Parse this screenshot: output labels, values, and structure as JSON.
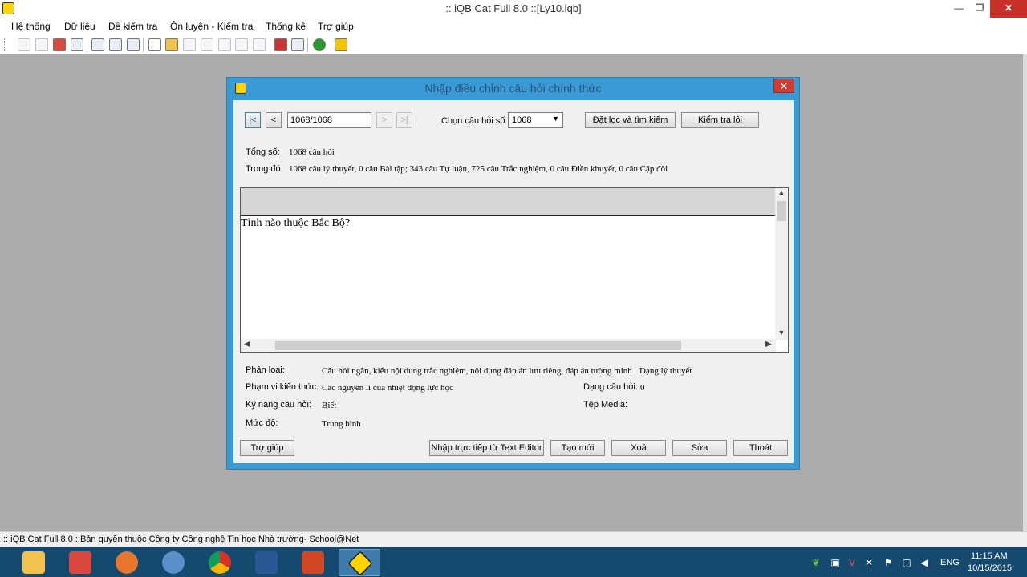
{
  "window": {
    "title": ":: iQB Cat Full 8.0 ::[Ly10.iqb]",
    "minimize_glyph": "—",
    "restore_glyph": "❐",
    "close_glyph": "✕"
  },
  "menu": {
    "items": [
      "Hệ thống",
      "Dữ liệu",
      "Đề kiểm tra",
      "Ôn luyện - Kiểm tra",
      "Thống kê",
      "Trợ giúp"
    ]
  },
  "dialog": {
    "title": "Nhập điều chỉnh câu hỏi chính thức",
    "close_glyph": "✕",
    "nav": {
      "first": "|<",
      "prev": "<",
      "position": "1068/1068",
      "next": ">",
      "last": ">|"
    },
    "select_label": "Chọn câu hỏi số:",
    "select_value": "1068",
    "filter_button": "Đặt lọc và tìm kiếm",
    "check_button": "Kiểm tra lỗi",
    "total_label": "Tổng số:",
    "total_value": "1068 câu hỏi",
    "breakdown_label": "Trong đó:",
    "breakdown_value": "1068 câu lý thuyết, 0 câu Bài tập; 343 câu Tự luận, 725 câu Trắc nghiệm, 0 câu Điền khuyết, 0 câu Cặp đôi",
    "question_text": "Tỉnh nào thuộc Bắc Bộ?",
    "classification_label": "Phân loại:",
    "classification_value": "Câu hỏi ngắn, kiểu nội dung trắc nghiệm, nội dung đáp án lưu riêng, đáp án tường minh",
    "classification_type": "Dạng lý thuyết",
    "scope_label": "Phạm vi kiến thức:",
    "scope_value": "Các nguyên lí của nhiệt động lực học",
    "qtype_label": "Dạng câu hỏi:",
    "qtype_value": "0",
    "skill_label": "Kỹ năng câu hỏi:",
    "skill_value": "Biết",
    "media_label": "Tệp Media:",
    "level_label": "Mức độ:",
    "level_value": "Trung bình",
    "buttons": {
      "help": "Trợ giúp",
      "text_editor": "Nhập trực tiếp từ Text Editor",
      "new": "Tạo mới",
      "delete": "Xoá",
      "edit": "Sửa",
      "exit": "Thoát"
    }
  },
  "statusbar": {
    "text": ":: iQB Cat Full 8.0 ::Bản quyền thuộc Công ty Công nghệ Tin học Nhà trường- School@Net"
  },
  "taskbar": {
    "apps": [
      {
        "icon": "file-explorer-icon",
        "color": "#f2c14e"
      },
      {
        "icon": "app-icon",
        "color": "#d9473f"
      },
      {
        "icon": "firefox-icon",
        "color": "#e8762d"
      },
      {
        "icon": "thunderbird-icon",
        "color": "#5b8fc9"
      },
      {
        "icon": "chrome-icon",
        "color": "#3a9a4a"
      },
      {
        "icon": "word-icon",
        "color": "#2b5797"
      },
      {
        "icon": "powerpoint-icon",
        "color": "#d24726"
      },
      {
        "icon": "iqb-icon",
        "color": "#ffd400"
      }
    ],
    "lang": "ENG",
    "time": "11:15 AM",
    "date": "10/15/2015"
  }
}
